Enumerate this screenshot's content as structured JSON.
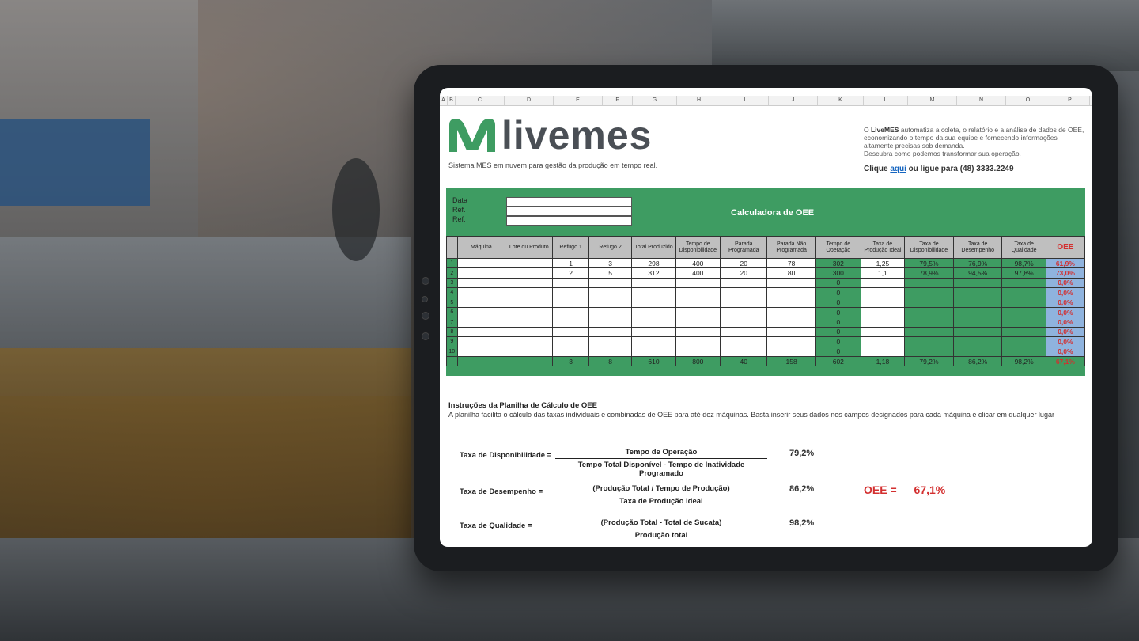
{
  "brand": {
    "name": "livemes",
    "tagline": "Sistema MES em nuvem para gestão da produção em tempo real."
  },
  "promo": {
    "lead": "O ",
    "brand": "LiveMES",
    "text": " automatiza a coleta, o relatório e a análise de dados de OEE, economizando o tempo da sua equipe e fornecendo informações altamente precisas sob demanda.",
    "line2": "Descubra como podemos transformar sua operação.",
    "cta_prefix": "Clique ",
    "cta_link": "aqui",
    "cta_suffix": " ou ligue para (48) 3333.2249"
  },
  "columns": [
    "A",
    "B",
    "C",
    "D",
    "E",
    "F",
    "G",
    "H",
    "I",
    "J",
    "K",
    "L",
    "M",
    "N",
    "O",
    "P"
  ],
  "sheet": {
    "title": "Calculadora de OEE",
    "meta_labels": [
      "Data",
      "Ref.",
      "Ref."
    ],
    "headers": [
      "Máquina",
      "Lote ou Produto",
      "Refugo 1",
      "Refugo 2",
      "Total Produzido",
      "Tempo de Disponibilidade",
      "Parada Programada",
      "Parada Não Programada",
      "Tempo de Operação",
      "Taxa de Produção Ideal",
      "Taxa de Disponibilidade",
      "Taxa de Desempenho",
      "Taxa de Qualidade",
      "OEE"
    ],
    "rows": [
      [
        "1",
        "",
        "",
        "1",
        "3",
        "298",
        "400",
        "20",
        "78",
        "302",
        "1,25",
        "79,5%",
        "76,9%",
        "98,7%",
        "61,9%"
      ],
      [
        "2",
        "",
        "",
        "2",
        "5",
        "312",
        "400",
        "20",
        "80",
        "300",
        "1,1",
        "78,9%",
        "94,5%",
        "97,8%",
        "73,0%"
      ],
      [
        "3",
        "",
        "",
        "",
        "",
        "",
        "",
        "",
        "",
        "0",
        "",
        "",
        "",
        "",
        "0,0%"
      ],
      [
        "4",
        "",
        "",
        "",
        "",
        "",
        "",
        "",
        "",
        "0",
        "",
        "",
        "",
        "",
        "0,0%"
      ],
      [
        "5",
        "",
        "",
        "",
        "",
        "",
        "",
        "",
        "",
        "0",
        "",
        "",
        "",
        "",
        "0,0%"
      ],
      [
        "6",
        "",
        "",
        "",
        "",
        "",
        "",
        "",
        "",
        "0",
        "",
        "",
        "",
        "",
        "0,0%"
      ],
      [
        "7",
        "",
        "",
        "",
        "",
        "",
        "",
        "",
        "",
        "0",
        "",
        "",
        "",
        "",
        "0,0%"
      ],
      [
        "8",
        "",
        "",
        "",
        "",
        "",
        "",
        "",
        "",
        "0",
        "",
        "",
        "",
        "",
        "0,0%"
      ],
      [
        "9",
        "",
        "",
        "",
        "",
        "",
        "",
        "",
        "",
        "0",
        "",
        "",
        "",
        "",
        "0,0%"
      ],
      [
        "10",
        "",
        "",
        "",
        "",
        "",
        "",
        "",
        "",
        "0",
        "",
        "",
        "",
        "",
        "0,0%"
      ]
    ],
    "totals": [
      "",
      "",
      "",
      "3",
      "8",
      "610",
      "800",
      "40",
      "158",
      "602",
      "1,18",
      "79,2%",
      "86,2%",
      "98,2%",
      "67,1%"
    ]
  },
  "instructions": {
    "title": "Instruções da Planilha de Cálculo de OEE",
    "text": "A planilha facilita o cálculo das taxas individuais e combinadas de OEE para até dez máquinas. Basta inserir seus dados nos campos designados para cada máquina e clicar em qualquer lugar"
  },
  "formulas": [
    {
      "label": "Taxa de Disponibilidade =",
      "num": "Tempo de Operação",
      "den": "Tempo Total Disponível - Tempo de Inatividade Programado",
      "value": "79,2%"
    },
    {
      "label": "Taxa de Desempenho =",
      "num": "(Produção Total / Tempo de Produção)",
      "den": "Taxa de Produção Ideal",
      "value": "86,2%"
    },
    {
      "label": "Taxa de Qualidade =",
      "num": "(Produção Total - Total de Sucata)",
      "den": "Produção total",
      "value": "98,2%"
    }
  ],
  "oee": {
    "label": "OEE =",
    "value": "67,1%"
  },
  "colors": {
    "green": "#3e9c62",
    "red": "#d32f2f",
    "blue": "#8fb3de"
  }
}
